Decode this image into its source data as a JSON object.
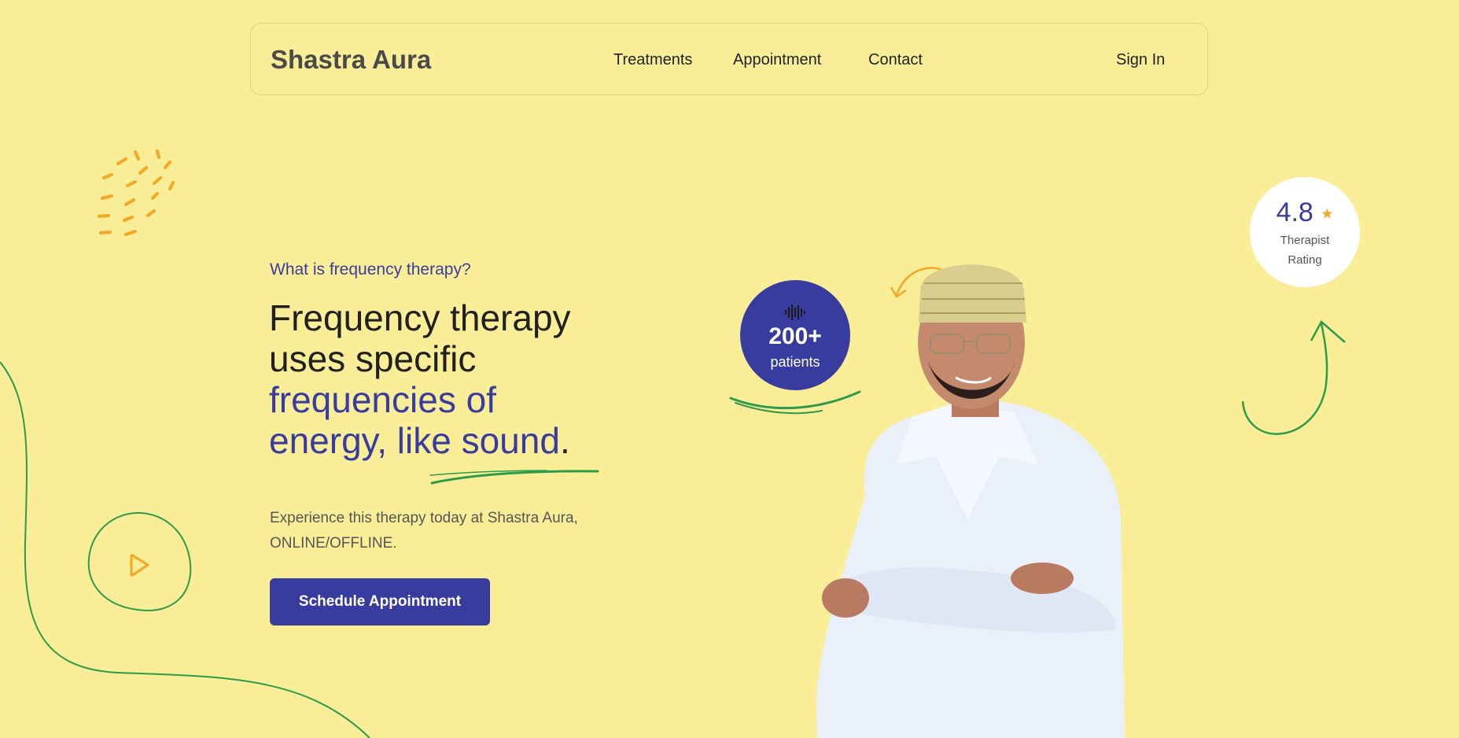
{
  "header": {
    "brand": "Shastra Aura",
    "nav": [
      "Treatments",
      "Appointment",
      "Contact"
    ],
    "sign_in": "Sign In"
  },
  "hero": {
    "eyebrow": "What is frequency therapy?",
    "headline_dark": "Frequency therapy uses specific",
    "headline_accent": "frequencies of energy, like sound",
    "headline_end": ".",
    "description": "Experience this therapy today at Shastra Aura, ONLINE/OFFLINE.",
    "cta": "Schedule Appointment"
  },
  "stats": {
    "patients_value": "200+",
    "patients_label": "patients",
    "rating_value": "4.8",
    "rating_label": "Therapist Rating"
  },
  "icons": [
    "sound-wave-icon",
    "star-icon",
    "play-icon"
  ],
  "colors": {
    "background": "#f9ee97",
    "accent_blue": "#383c9f",
    "accent_green": "#2e9a4a",
    "accent_orange": "#f5a623"
  }
}
